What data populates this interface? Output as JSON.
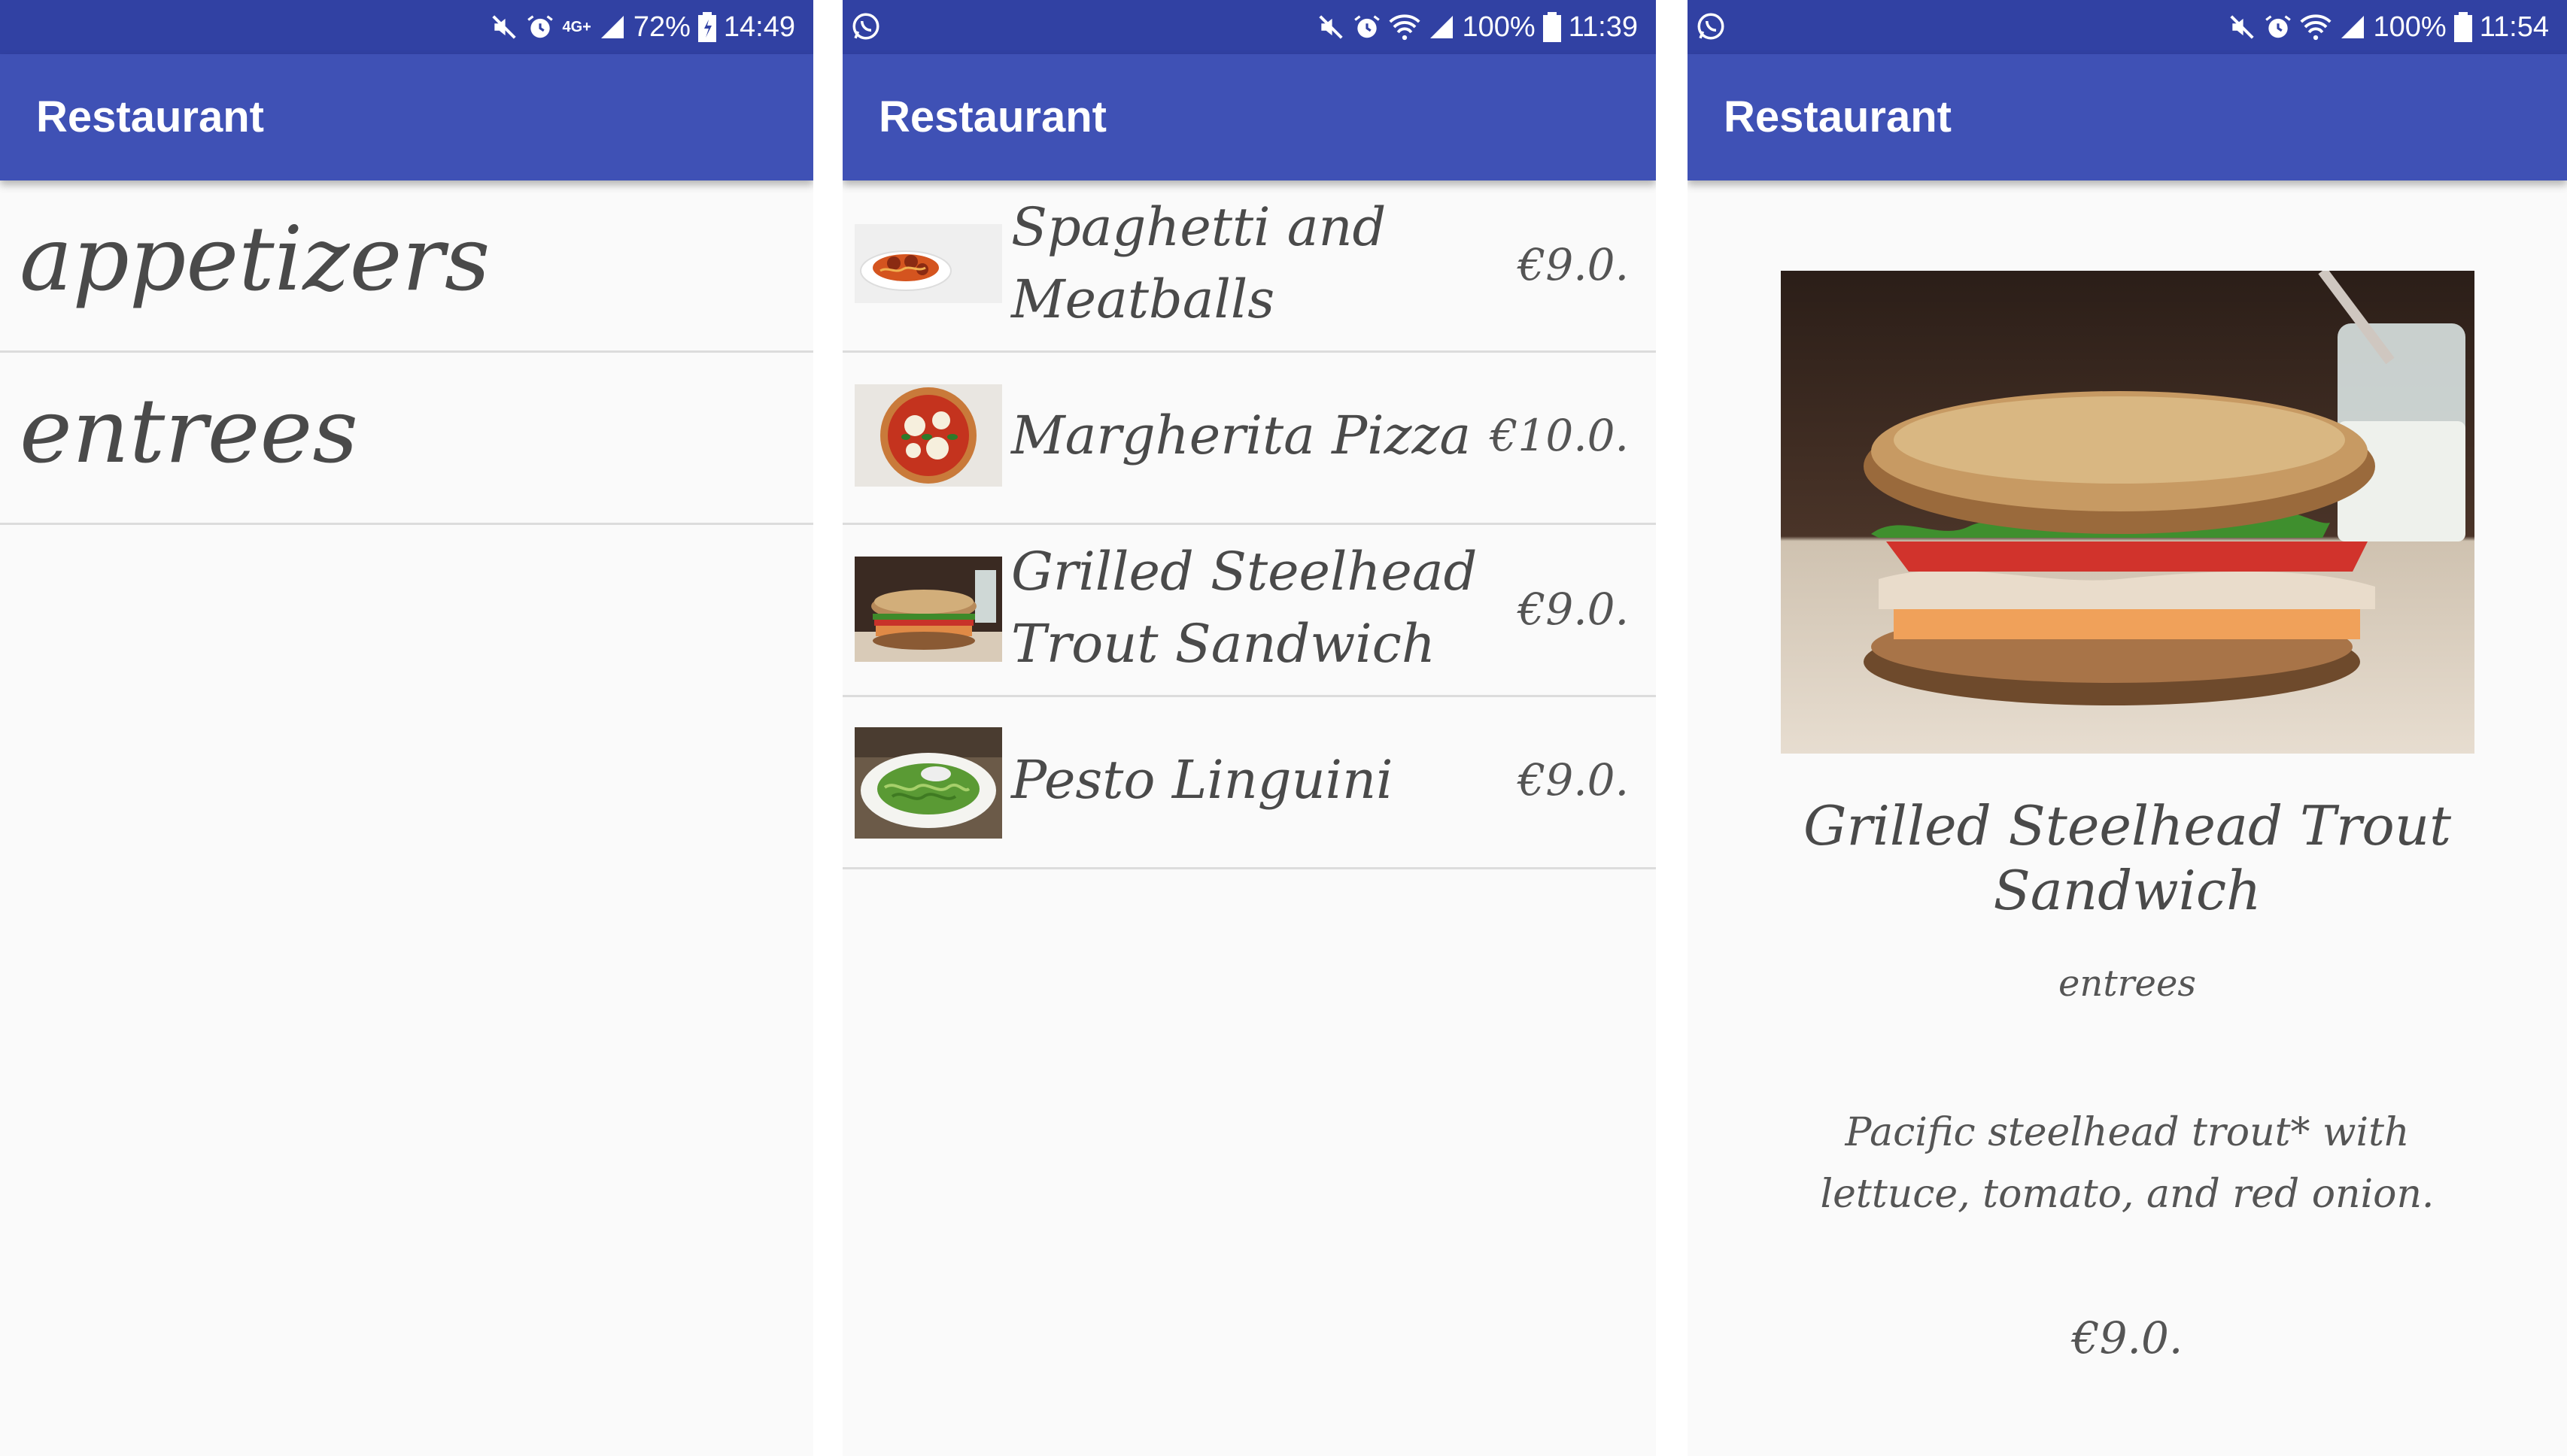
{
  "screens": [
    {
      "status": {
        "network": "4G+",
        "battery": "72%",
        "time": "14:49"
      },
      "app_title": "Restaurant",
      "categories": [
        "appetizers",
        "entrees"
      ]
    },
    {
      "status": {
        "battery": "100%",
        "time": "11:39"
      },
      "app_title": "Restaurant",
      "items": [
        {
          "name": "Spaghetti and Meatballs",
          "price": "€9.0.",
          "thumb": "spaghetti-thumbnail"
        },
        {
          "name": "Margherita Pizza",
          "price": "€10.0.",
          "thumb": "pizza-thumbnail"
        },
        {
          "name": "Grilled Steelhead Trout Sandwich",
          "price": "€9.0.",
          "thumb": "sandwich-thumbnail"
        },
        {
          "name": "Pesto Linguini",
          "price": "€9.0.",
          "thumb": "pesto-thumbnail"
        }
      ]
    },
    {
      "status": {
        "battery": "100%",
        "time": "11:54"
      },
      "app_title": "Restaurant",
      "detail": {
        "name": "Grilled Steelhead Trout Sandwich",
        "category": "entrees",
        "description": "Pacific steelhead trout* with lettuce, tomato, and red onion.",
        "price": "€9.0."
      }
    }
  ],
  "colors": {
    "status_bar": "#3141a3",
    "app_bar": "#3f51b5",
    "background": "#fafafa",
    "divider": "#dcdcdc",
    "text": "#555555"
  },
  "icons": [
    "whatsapp-icon",
    "mute-icon",
    "alarm-icon",
    "wifi-icon",
    "signal-icon",
    "battery-icon"
  ]
}
